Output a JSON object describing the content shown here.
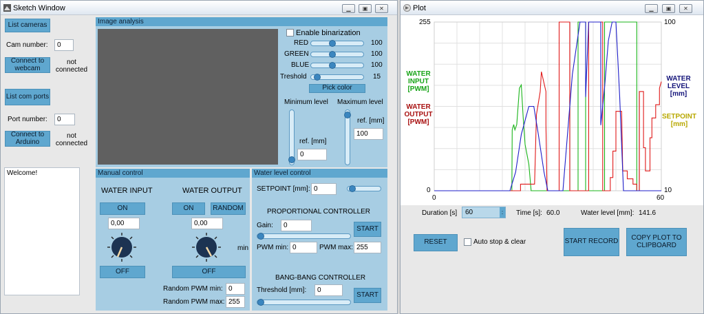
{
  "sketch": {
    "title": "Sketch Window",
    "list_cameras": "List cameras",
    "cam_number_label": "Cam number:",
    "cam_number_value": "0",
    "connect_webcam": "Connect to webcam",
    "webcam_status": "not connected",
    "list_com_ports": "List com ports",
    "port_number_label": "Port number:",
    "port_number_value": "0",
    "connect_arduino": "Connect to Arduino",
    "arduino_status": "not connected",
    "log_text": "Welcome!",
    "image_analysis": {
      "header": "Image analysis",
      "enable_binarization": "Enable binarization",
      "red_label": "RED",
      "red_value": "100",
      "red_level": 0.4,
      "green_label": "GREEN",
      "green_value": "100",
      "green_level": 0.4,
      "blue_label": "BLUE",
      "blue_value": "100",
      "blue_level": 0.4,
      "threshold_label": "Treshold",
      "threshold_value": "15",
      "threshold_level": 0.06,
      "pick_color": "Pick color",
      "min_level_label": "Minimum level",
      "max_level_label": "Maximum level",
      "ref_min_label": "ref. [mm]",
      "ref_min_value": "0",
      "ref_max_label": "ref. [mm]",
      "ref_max_value": "100"
    },
    "manual": {
      "header": "Manual control",
      "water_input": "WATER INPUT",
      "water_output": "WATER OUTPUT",
      "on_input": "ON",
      "on_output": "ON",
      "random": "RANDOM",
      "input_value": "0,00",
      "output_value": "0,00",
      "min_label": "min",
      "off_input": "OFF",
      "off_output": "OFF",
      "random_min_label": "Random PWM min:",
      "random_min_value": "0",
      "random_max_label": "Random PWM max:",
      "random_max_value": "255"
    },
    "level": {
      "header": "Water level control",
      "setpoint_label": "SETPOINT [mm]:",
      "setpoint_value": "0",
      "prop_title": "PROPORTIONAL CONTROLLER",
      "gain_label": "Gain:",
      "gain_value": "0",
      "start_prop": "START",
      "pwm_min_label": "PWM min:",
      "pwm_min_value": "0",
      "pwm_max_label": "PWM max:",
      "pwm_max_value": "255",
      "bang_title": "BANG-BANG CONTROLLER",
      "threshold_label": "Threshold [mm]:",
      "threshold_value": "0",
      "start_bang": "START"
    }
  },
  "plot": {
    "title": "Plot",
    "y_left_top": "255",
    "y_left_bottom": "0",
    "y_right_top": "100",
    "y_right_bottom": "10",
    "x_left": "0",
    "x_right": "60",
    "legend_water_input": "WATER INPUT [PWM]",
    "legend_water_output": "WATER OUTPUT [PWM]",
    "legend_water_level": "WATER LEVEL [mm]",
    "legend_setpoint": "SETPOINT [mm]",
    "duration_label": "Duration [s]",
    "duration_value": "60",
    "time_label": "Time [s]:",
    "time_value": "60.0",
    "water_level_label": "Water level [mm]:",
    "water_level_value": "141.6",
    "reset": "RESET",
    "auto_stop": "Auto stop & clear",
    "start_record": "START RECORD",
    "copy_plot": "COPY PLOT TO CLIPBOARD",
    "colors": {
      "input": "#18b418",
      "output": "#e01818",
      "level": "#1c1cc8",
      "setpoint": "#b8a800"
    }
  },
  "chart_data": {
    "type": "line",
    "xlim": [
      0,
      60
    ],
    "ylim": [
      0,
      255
    ],
    "y2lim": [
      10,
      100
    ],
    "grid": true,
    "series": [
      {
        "name": "WATER INPUT [PWM]",
        "color": "#18b418",
        "axis": "left",
        "points": [
          [
            0,
            0
          ],
          [
            20.5,
            0
          ],
          [
            20.6,
            92
          ],
          [
            21,
            100
          ],
          [
            21.3,
            92
          ],
          [
            21.8,
            100
          ],
          [
            22.5,
            155
          ],
          [
            23,
            160
          ],
          [
            23.5,
            110
          ],
          [
            24,
            70
          ],
          [
            25,
            40
          ],
          [
            25.6,
            0
          ],
          [
            38,
            0
          ],
          [
            38,
            255
          ],
          [
            40,
            255
          ],
          [
            40,
            0
          ],
          [
            45,
            0
          ],
          [
            45,
            255
          ],
          [
            53.5,
            255
          ],
          [
            53.5,
            0
          ],
          [
            60,
            0
          ]
        ]
      },
      {
        "name": "WATER OUTPUT [PWM]",
        "color": "#e01818",
        "axis": "left",
        "points": [
          [
            0,
            0
          ],
          [
            22.8,
            0
          ],
          [
            22.8,
            10
          ],
          [
            26.5,
            10
          ],
          [
            27,
            115
          ],
          [
            28,
            150
          ],
          [
            28.3,
            180
          ],
          [
            29.5,
            150
          ],
          [
            29.5,
            100
          ],
          [
            29.8,
            0
          ],
          [
            33,
            0
          ],
          [
            33,
            255
          ],
          [
            35.8,
            255
          ],
          [
            35.8,
            0
          ],
          [
            40.8,
            0
          ],
          [
            40.8,
            255
          ],
          [
            44.5,
            255
          ],
          [
            44.5,
            0
          ],
          [
            46.5,
            0
          ],
          [
            46.5,
            20
          ],
          [
            47.2,
            20
          ],
          [
            47.2,
            60
          ],
          [
            48,
            60
          ],
          [
            48,
            120
          ],
          [
            49.5,
            120
          ],
          [
            49.8,
            30
          ],
          [
            51,
            30
          ],
          [
            51,
            18
          ],
          [
            52.5,
            18
          ],
          [
            52.5,
            10
          ],
          [
            53.5,
            10
          ],
          [
            53.5,
            0
          ],
          [
            54.2,
            0
          ],
          [
            54.2,
            150
          ],
          [
            55.3,
            150
          ],
          [
            55.3,
            65
          ],
          [
            55.8,
            65
          ],
          [
            55.8,
            30
          ],
          [
            57,
            30
          ],
          [
            57,
            80
          ],
          [
            57.5,
            80
          ],
          [
            57.5,
            110
          ],
          [
            58.5,
            110
          ],
          [
            58.5,
            130
          ],
          [
            59.5,
            130
          ],
          [
            59.5,
            155
          ],
          [
            60,
            165
          ]
        ]
      },
      {
        "name": "WATER LEVEL [mm]",
        "color": "#1c1cc8",
        "axis": "right",
        "points": [
          [
            0,
            10
          ],
          [
            20,
            10
          ],
          [
            21.5,
            20
          ],
          [
            23,
            40
          ],
          [
            25,
            55
          ],
          [
            26.3,
            55
          ],
          [
            27.5,
            40
          ],
          [
            29,
            20
          ],
          [
            30,
            10
          ],
          [
            34,
            10
          ],
          [
            36.5,
            72
          ],
          [
            38.5,
            100
          ],
          [
            40,
            100
          ],
          [
            40,
            60
          ],
          [
            40.8,
            100
          ],
          [
            44,
            100
          ],
          [
            44,
            45
          ],
          [
            45,
            65
          ],
          [
            46,
            90
          ],
          [
            47,
            100
          ],
          [
            48,
            100
          ],
          [
            48.5,
            80
          ],
          [
            49,
            60
          ],
          [
            50,
            10
          ],
          [
            60,
            10
          ]
        ]
      },
      {
        "name": "SETPOINT [mm]",
        "color": "#b8a800",
        "axis": "right",
        "points": []
      }
    ]
  }
}
